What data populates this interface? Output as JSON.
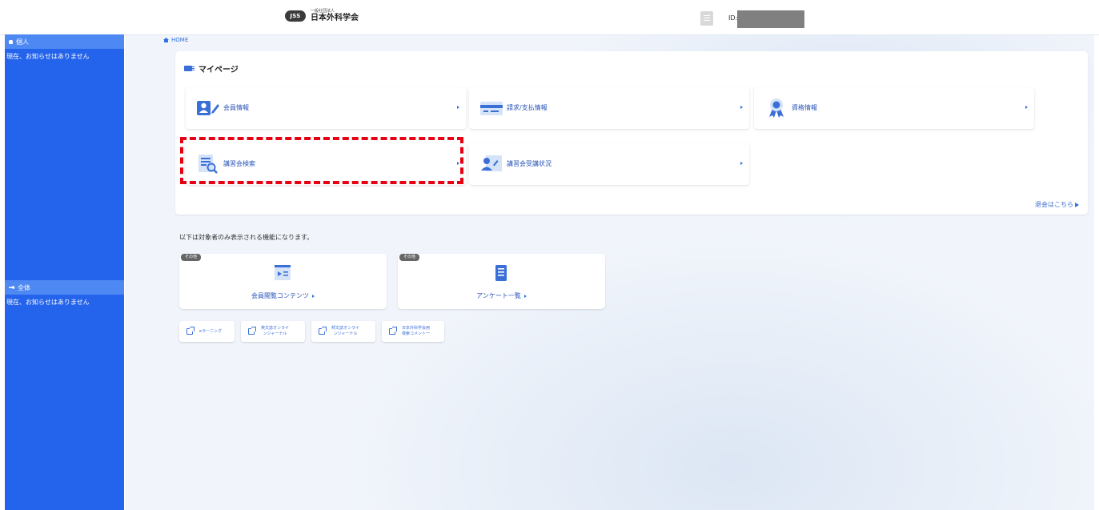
{
  "header": {
    "logo_badge": "JSS",
    "logo_sub": "一般社団法人",
    "logo_main": "日本外科学会",
    "id_label": "ID:"
  },
  "sidebar": {
    "personal_heading": "個人",
    "personal_notice": "現在、お知らせはありません",
    "all_heading": "全体",
    "all_notice": "現在、お知らせはありません"
  },
  "breadcrumb": {
    "home": "HOME"
  },
  "mypage": {
    "title": "マイページ",
    "items": [
      {
        "label": "会員情報",
        "icon": "member-info-icon"
      },
      {
        "label": "請求/支払情報",
        "icon": "billing-card-icon"
      },
      {
        "label": "資格情報",
        "icon": "certificate-ribbon-icon"
      },
      {
        "label": "講習会検索",
        "icon": "document-search-icon"
      },
      {
        "label": "講習会受講状況",
        "icon": "attendance-status-icon"
      }
    ],
    "withdraw": "退会はこちら"
  },
  "notice": "以下は対象者のみ表示される機能になります。",
  "features": [
    {
      "tag": "その他",
      "label": "会員閲覧コンテンツ"
    },
    {
      "tag": "その他",
      "label": "アンケート一覧"
    }
  ],
  "links": [
    {
      "line1": "eラーニング",
      "line2": ""
    },
    {
      "line1": "英文誌オンライ",
      "line2": "ンジャーナル"
    },
    {
      "line1": "邦文誌オンライ",
      "line2": "ンジャーナル"
    },
    {
      "line1": "日本外科学会用",
      "line2": "検索コメント一"
    }
  ],
  "colors": {
    "sidebar": "#2463eb",
    "sidebar_heading": "#4e88f2",
    "accent": "#2f6fe0",
    "highlight": "#e60012"
  }
}
